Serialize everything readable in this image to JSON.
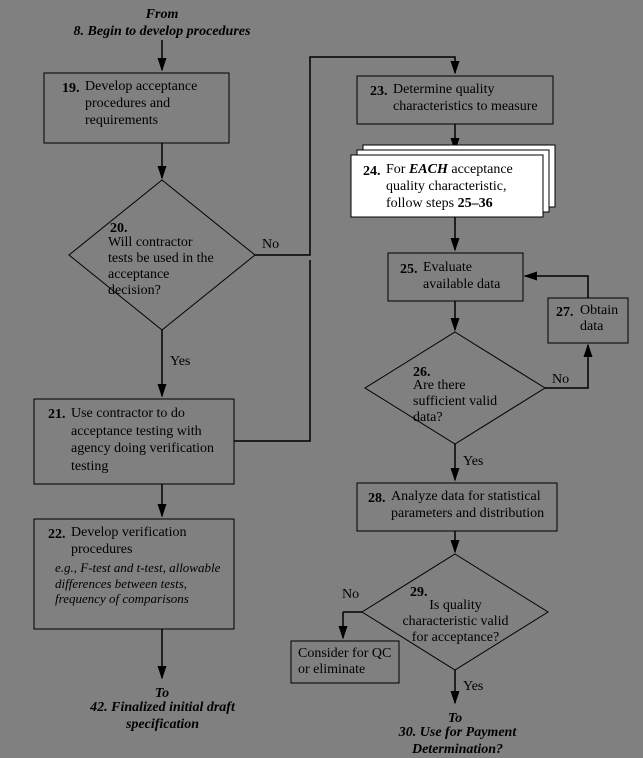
{
  "header": {
    "from_label": "From",
    "from_ref": "8. Begin to develop procedures"
  },
  "nodes": {
    "n19": {
      "num": "19.",
      "text": "Develop acceptance procedures and requirements"
    },
    "n20": {
      "num": "20.",
      "text": "Will contractor tests be used in the acceptance decision?"
    },
    "n21": {
      "num": "21.",
      "text": "Use contractor to do acceptance testing with agency doing verification testing"
    },
    "n22": {
      "num": "22.",
      "text1": "Develop verification procedures",
      "text2": "e.g., F-test and t-test, allowable differences between tests, frequency of comparisons"
    },
    "n23": {
      "num": "23.",
      "text": "Determine quality characteristics to measure"
    },
    "n24": {
      "num": "24.",
      "pre": "For ",
      "em": "EACH",
      "post": " acceptance quality characteristic, follow steps ",
      "range": "25–36"
    },
    "n25": {
      "num": "25.",
      "text": "Evaluate available data"
    },
    "n26": {
      "num": "26.",
      "text": "Are there sufficient valid data?"
    },
    "n27": {
      "num": "27.",
      "text": "Obtain data"
    },
    "n28": {
      "num": "28.",
      "text": "Analyze data for statistical parameters and distribution"
    },
    "n29": {
      "num": "29.",
      "text": "Is quality characteristic valid for acceptance?"
    },
    "qc": {
      "text": "Consider for QC or eliminate"
    }
  },
  "labels": {
    "yes": "Yes",
    "no": "No",
    "to": "To"
  },
  "footers": {
    "left": "42. Finalized initial draft specification",
    "right": "30. Use for Payment Determination?"
  }
}
